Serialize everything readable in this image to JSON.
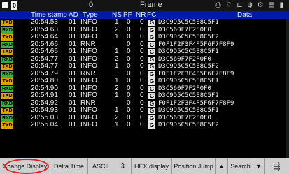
{
  "topbar": {
    "counter": "0",
    "zero": "0",
    "title": "Frame",
    "icons": [
      "printer-icon",
      "wifi-icon",
      "lan-icon",
      "usb-icon",
      "settings-icon",
      "file-icon",
      "battery-icon"
    ]
  },
  "headers": {
    "time": "Time stamp",
    "ad": "AD",
    "type": "Type",
    "ns": "NS",
    "pf": "PF",
    "nr": "NR",
    "fc": "FC",
    "data": "Data"
  },
  "rows": [
    {
      "dir": "TXD",
      "time": "20:54.53",
      "ad": "01",
      "type": "INFO",
      "ns": "1",
      "pf": "0",
      "nr": "0",
      "fc": "G",
      "data": "D3C9D5C5C5E8C5F1"
    },
    {
      "dir": "RXD",
      "time": "20:54.63",
      "ad": "01",
      "type": "INFO",
      "ns": "2",
      "pf": "0",
      "nr": "0",
      "fc": "G",
      "data": "D3C560F7F2F0F0"
    },
    {
      "dir": "TXD",
      "time": "20:54.64",
      "ad": "01",
      "type": "INFO",
      "ns": "1",
      "pf": "0",
      "nr": "0",
      "fc": "G",
      "data": "D3C9D5C5C5E8C5F2"
    },
    {
      "dir": "RXD",
      "time": "20:54.66",
      "ad": "01",
      "type": "RNR",
      "ns": "",
      "pf": "0",
      "nr": "0",
      "fc": "G",
      "data": "F0F1F2F3F4F5F6F7F8F9"
    },
    {
      "dir": "TXD",
      "time": "20:54.66",
      "ad": "01",
      "type": "INFO",
      "ns": "1",
      "pf": "0",
      "nr": "0",
      "fc": "G",
      "data": "D3C9D5C5C5E8C5F1"
    },
    {
      "dir": "RXD",
      "time": "20:54.77",
      "ad": "01",
      "type": "INFO",
      "ns": "2",
      "pf": "0",
      "nr": "0",
      "fc": "G",
      "data": "D3C560F7F2F0F0"
    },
    {
      "dir": "TXD",
      "time": "20:54.77",
      "ad": "01",
      "type": "INFO",
      "ns": "1",
      "pf": "0",
      "nr": "0",
      "fc": "G",
      "data": "D3C9D5C5C5E8C5F2"
    },
    {
      "dir": "RXD",
      "time": "20:54.79",
      "ad": "01",
      "type": "RNR",
      "ns": "",
      "pf": "0",
      "nr": "0",
      "fc": "G",
      "data": "F0F1F2F3F4F5F6F7F8F9"
    },
    {
      "dir": "TXD",
      "time": "20:54.80",
      "ad": "01",
      "type": "INFO",
      "ns": "1",
      "pf": "0",
      "nr": "0",
      "fc": "G",
      "data": "D3C9D5C5C5E8C5F1"
    },
    {
      "dir": "RXD",
      "time": "20:54.90",
      "ad": "01",
      "type": "INFO",
      "ns": "2",
      "pf": "0",
      "nr": "0",
      "fc": "G",
      "data": "D3C560F7F2F0F0"
    },
    {
      "dir": "TXD",
      "time": "20:54.91",
      "ad": "01",
      "type": "INFO",
      "ns": "1",
      "pf": "0",
      "nr": "0",
      "fc": "G",
      "data": "D3C9D5C5C5E8C5F2"
    },
    {
      "dir": "RXD",
      "time": "20:54.92",
      "ad": "01",
      "type": "RNR",
      "ns": "",
      "pf": "0",
      "nr": "0",
      "fc": "G",
      "data": "F0F1F2F3F4F5F6F7F8F9"
    },
    {
      "dir": "TXD",
      "time": "20:54.93",
      "ad": "01",
      "type": "INFO",
      "ns": "1",
      "pf": "0",
      "nr": "0",
      "fc": "G",
      "data": "D3C9D5C5C5E8C5F1"
    },
    {
      "dir": "RXD",
      "time": "20:55.03",
      "ad": "01",
      "type": "INFO",
      "ns": "2",
      "pf": "0",
      "nr": "0",
      "fc": "G",
      "data": "D3C560F7F2F0F0"
    },
    {
      "dir": "TXD",
      "time": "20:55.04",
      "ad": "01",
      "type": "INFO",
      "ns": "1",
      "pf": "0",
      "nr": "0",
      "fc": "G",
      "data": "D3C9D5C5C5E8C5F2"
    }
  ],
  "toolbar": {
    "change_display": "Change Display",
    "delta_time": "Delta Time",
    "ascii": "ASCII",
    "updown": "⇕",
    "hex_display": "HEX display",
    "position_jump": "Position Jump",
    "up_arrow": "▲",
    "search": "Search",
    "down_arrow": "▼",
    "menu": "⇶"
  },
  "colors": {
    "header_bg": "#001aa8",
    "txd": "#d9a300",
    "rxd": "#3cae49",
    "highlight_circle": "#e32020"
  }
}
